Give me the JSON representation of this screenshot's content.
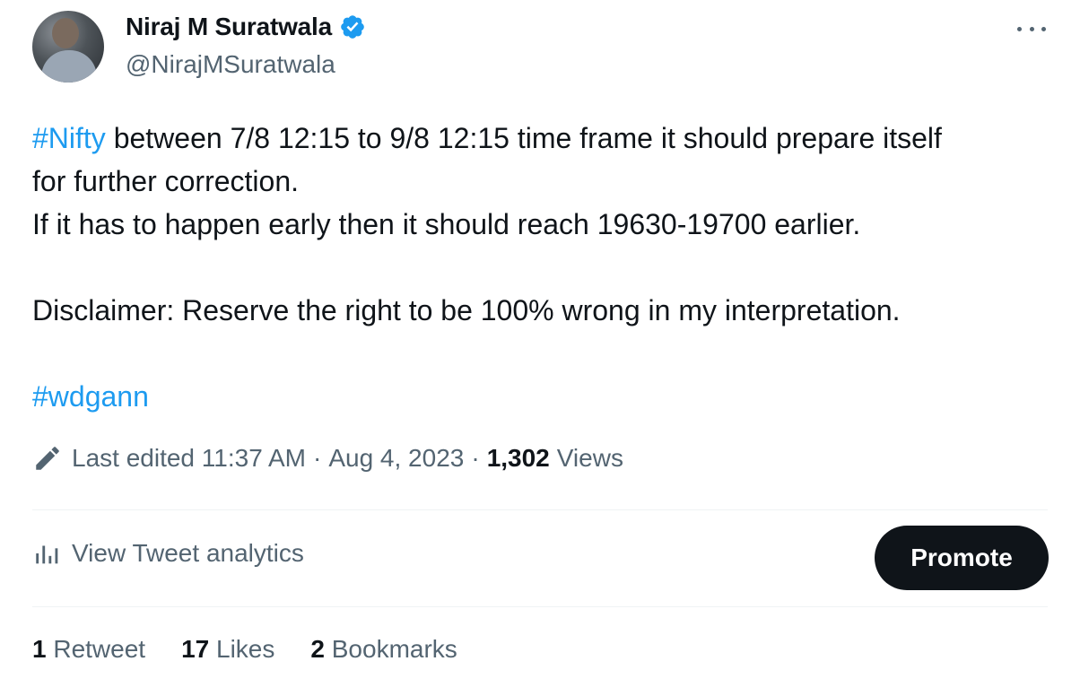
{
  "author": {
    "display_name": "Niraj M Suratwala",
    "handle": "@NirajMSuratwala",
    "verified": true,
    "verified_color": "#1d9bf0"
  },
  "tweet": {
    "hashtag1": "#Nifty",
    "line1_rest": " between 7/8 12:15 to 9/8 12:15 time frame it should prepare itself\nfor further correction.\nIf it has to happen early then it should reach 19630-19700 earlier.\n\nDisclaimer: Reserve the right to be 100% wrong in my interpretation.\n\n",
    "hashtag2": "#wdgann"
  },
  "meta": {
    "edited_label": "Last edited 11:37 AM",
    "separator": "·",
    "date": "Aug 4, 2023",
    "views_count": "1,302",
    "views_label": "Views"
  },
  "actions": {
    "analytics_label": "View Tweet analytics",
    "promote_label": "Promote"
  },
  "stats": {
    "retweets_count": "1",
    "retweets_label": "Retweet",
    "likes_count": "17",
    "likes_label": "Likes",
    "bookmarks_count": "2",
    "bookmarks_label": "Bookmarks"
  },
  "icons": {
    "more": "more-options-icon",
    "verified": "verified-badge-icon",
    "edit": "pencil-icon",
    "analytics": "bar-chart-icon"
  },
  "colors": {
    "link": "#1d9bf0",
    "text": "#0f1419",
    "secondary": "#536471",
    "button_bg": "#0f1419"
  }
}
